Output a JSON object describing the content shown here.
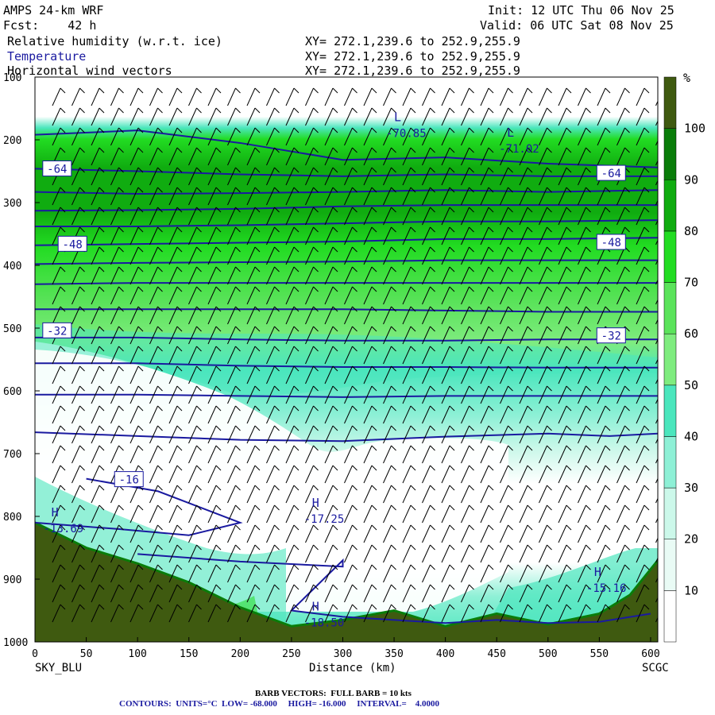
{
  "header": {
    "model": "AMPS 24-km WRF",
    "fcst": "Fcst:    42 h",
    "init": "Init: 12 UTC Thu 06 Nov 25",
    "valid": "Valid: 06 UTC Sat 08 Nov 25",
    "fields": [
      {
        "name": "Relative humidity (w.r.t. ice)",
        "xy": "XY= 272.1,239.6 to 252.9,255.9",
        "color": "#000000"
      },
      {
        "name": "Temperature",
        "xy": "XY= 272.1,239.6 to 252.9,255.9",
        "color": "#1a1aa0"
      },
      {
        "name": "Horizontal wind vectors",
        "xy": "XY= 272.1,239.6 to 252.9,255.9",
        "color": "#000000"
      }
    ]
  },
  "axes": {
    "xlabel": "Distance (km)",
    "left_endpoint": "SKY_BLU",
    "right_endpoint": "SCGC",
    "xticks": [
      0,
      50,
      100,
      150,
      200,
      250,
      300,
      350,
      400,
      450,
      500,
      550,
      600
    ],
    "yticks": [
      100,
      200,
      300,
      400,
      500,
      600,
      700,
      800,
      900,
      1000
    ],
    "xlim": [
      0,
      607
    ],
    "ylim": [
      100,
      1000
    ]
  },
  "footer": {
    "barb": "BARB VECTORS:  FULL BARB = 10 kts",
    "contours": "CONTOURS:  UNITS=°C  LOW= -68.000     HIGH= -16.000     INTERVAL=    4.0000"
  },
  "colorbar": {
    "unit": "%",
    "labels": [
      10,
      20,
      30,
      40,
      50,
      60,
      70,
      80,
      90,
      100
    ],
    "colors": [
      "#ffffff",
      "#e9fbf5",
      "#ccf8ea",
      "#8ef0d6",
      "#4be6bd",
      "#7fec7f",
      "#5be35b",
      "#22dc22",
      "#10ac10",
      "#0a7d0a",
      "#3f5a10"
    ]
  },
  "chart_data": {
    "type": "heatmap",
    "title": "Relative humidity (w.r.t. ice)",
    "x_units": "km",
    "y_units": "hPa",
    "temperature_contour_labels": [
      "-64",
      "-64",
      "-48",
      "-48",
      "-32",
      "-32",
      "-16"
    ],
    "extrema": [
      {
        "type": "L",
        "value": "-70.85",
        "x": 350,
        "y": 170
      },
      {
        "type": "L",
        "value": "-71.02",
        "x": 460,
        "y": 195
      },
      {
        "type": "H",
        "value": "-13.69",
        "x": 16,
        "y": 800
      },
      {
        "type": "H",
        "value": "-17.25",
        "x": 270,
        "y": 785
      },
      {
        "type": "H",
        "value": "-18.50",
        "x": 270,
        "y": 950
      },
      {
        "type": "H",
        "value": "-15.16",
        "x": 545,
        "y": 895
      }
    ],
    "temperature_contours": [
      {
        "value": -68,
        "pts": [
          [
            0,
            192
          ],
          [
            100,
            185
          ],
          [
            200,
            205
          ],
          [
            300,
            232
          ],
          [
            400,
            228
          ],
          [
            500,
            238
          ],
          [
            607,
            244
          ]
        ]
      },
      {
        "value": -64,
        "pts": [
          [
            0,
            246
          ],
          [
            100,
            250
          ],
          [
            200,
            255
          ],
          [
            300,
            258
          ],
          [
            400,
            255
          ],
          [
            500,
            258
          ],
          [
            607,
            258
          ]
        ]
      },
      {
        "value": -60,
        "pts": [
          [
            0,
            283
          ],
          [
            100,
            286
          ],
          [
            200,
            285
          ],
          [
            300,
            283
          ],
          [
            400,
            280
          ],
          [
            500,
            283
          ],
          [
            607,
            280
          ]
        ]
      },
      {
        "value": -56,
        "pts": [
          [
            0,
            313
          ],
          [
            100,
            312
          ],
          [
            200,
            310
          ],
          [
            300,
            306
          ],
          [
            400,
            304
          ],
          [
            500,
            304
          ],
          [
            607,
            304
          ]
        ]
      },
      {
        "value": -52,
        "pts": [
          [
            0,
            338
          ],
          [
            100,
            338
          ],
          [
            200,
            336
          ],
          [
            300,
            333
          ],
          [
            400,
            330
          ],
          [
            500,
            330
          ],
          [
            607,
            328
          ]
        ]
      },
      {
        "value": -48,
        "pts": [
          [
            0,
            368
          ],
          [
            100,
            366
          ],
          [
            200,
            364
          ],
          [
            300,
            362
          ],
          [
            400,
            358
          ],
          [
            500,
            358
          ],
          [
            607,
            356
          ]
        ]
      },
      {
        "value": -44,
        "pts": [
          [
            0,
            398
          ],
          [
            100,
            396
          ],
          [
            200,
            395
          ],
          [
            300,
            394
          ],
          [
            400,
            392
          ],
          [
            500,
            392
          ],
          [
            607,
            392
          ]
        ]
      },
      {
        "value": -40,
        "pts": [
          [
            0,
            430
          ],
          [
            100,
            428
          ],
          [
            200,
            428
          ],
          [
            300,
            428
          ],
          [
            400,
            428
          ],
          [
            500,
            428
          ],
          [
            607,
            428
          ]
        ]
      },
      {
        "value": -36,
        "pts": [
          [
            0,
            470
          ],
          [
            100,
            470
          ],
          [
            200,
            470
          ],
          [
            300,
            470
          ],
          [
            400,
            472
          ],
          [
            500,
            474
          ],
          [
            607,
            474
          ]
        ]
      },
      {
        "value": -32,
        "pts": [
          [
            0,
            515
          ],
          [
            100,
            515
          ],
          [
            200,
            518
          ],
          [
            300,
            520
          ],
          [
            400,
            520
          ],
          [
            500,
            518
          ],
          [
            607,
            518
          ]
        ]
      },
      {
        "value": -28,
        "pts": [
          [
            0,
            556
          ],
          [
            100,
            556
          ],
          [
            200,
            560
          ],
          [
            300,
            562
          ],
          [
            400,
            562
          ],
          [
            500,
            563
          ],
          [
            607,
            563
          ]
        ]
      },
      {
        "value": -24,
        "pts": [
          [
            0,
            606
          ],
          [
            100,
            606
          ],
          [
            200,
            608
          ],
          [
            300,
            610
          ],
          [
            400,
            608
          ],
          [
            500,
            608
          ],
          [
            607,
            608
          ]
        ]
      },
      {
        "value": -20,
        "pts": [
          [
            0,
            666
          ],
          [
            100,
            672
          ],
          [
            200,
            678
          ],
          [
            300,
            680
          ],
          [
            400,
            673
          ],
          [
            500,
            668
          ],
          [
            560,
            672
          ],
          [
            607,
            668
          ]
        ]
      },
      {
        "value": -16,
        "pts": [
          [
            50,
            740
          ],
          [
            120,
            760
          ],
          [
            200,
            810
          ],
          [
            150,
            830
          ],
          [
            80,
            820
          ],
          [
            0,
            810
          ]
        ]
      },
      {
        "value": -20,
        "pts": [
          [
            100,
            860
          ],
          [
            200,
            872
          ],
          [
            300,
            880
          ],
          [
            300,
            870
          ],
          [
            250,
            950
          ],
          [
            300,
            960
          ],
          [
            350,
            965
          ],
          [
            400,
            970
          ],
          [
            450,
            965
          ],
          [
            500,
            970
          ],
          [
            550,
            968
          ],
          [
            600,
            955
          ]
        ]
      }
    ],
    "terrain_hpa_by_km": [
      [
        0,
        810
      ],
      [
        50,
        850
      ],
      [
        100,
        875
      ],
      [
        150,
        905
      ],
      [
        200,
        945
      ],
      [
        250,
        975
      ],
      [
        300,
        965
      ],
      [
        350,
        950
      ],
      [
        400,
        975
      ],
      [
        450,
        955
      ],
      [
        500,
        972
      ],
      [
        550,
        955
      ],
      [
        580,
        925
      ],
      [
        607,
        870
      ]
    ]
  }
}
